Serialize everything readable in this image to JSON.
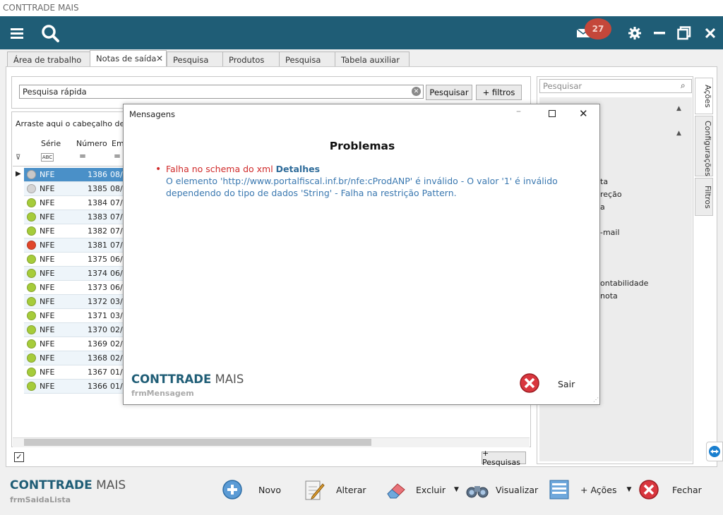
{
  "window": {
    "title": "CONTTRADE MAIS"
  },
  "header": {
    "notification_count": "27",
    "accent": "#1f5d76"
  },
  "tabs": [
    {
      "label": "Área de trabalho"
    },
    {
      "label": "Notas de saída"
    },
    {
      "label": "Pesquisa"
    },
    {
      "label": "Produtos"
    },
    {
      "label": "Pesquisa"
    },
    {
      "label": "Tabela auxiliar"
    }
  ],
  "search": {
    "placeholder": "Pesquisa rápida",
    "search_button": "Pesquisar",
    "filters_button": "+ filtros"
  },
  "grid": {
    "group_hint": "Arraste aqui o cabeçalho de uma coluna",
    "columns": [
      "Série",
      "Número",
      "Emissão"
    ],
    "filter_symbol": "=",
    "rows": [
      {
        "status": "#c8c8c8",
        "serie": "NFE",
        "numero": "1386",
        "data": "08/"
      },
      {
        "status": "#d4d4d4",
        "serie": "NFE",
        "numero": "1385",
        "data": "08/"
      },
      {
        "status": "#a6cc3a",
        "serie": "NFE",
        "numero": "1384",
        "data": "07/"
      },
      {
        "status": "#a6cc3a",
        "serie": "NFE",
        "numero": "1383",
        "data": "07/"
      },
      {
        "status": "#a6cc3a",
        "serie": "NFE",
        "numero": "1382",
        "data": "07/"
      },
      {
        "status": "#e0452a",
        "serie": "NFE",
        "numero": "1381",
        "data": "07/"
      },
      {
        "status": "#a6cc3a",
        "serie": "NFE",
        "numero": "1375",
        "data": "06/"
      },
      {
        "status": "#a6cc3a",
        "serie": "NFE",
        "numero": "1374",
        "data": "06/"
      },
      {
        "status": "#a6cc3a",
        "serie": "NFE",
        "numero": "1373",
        "data": "06/"
      },
      {
        "status": "#a6cc3a",
        "serie": "NFE",
        "numero": "1372",
        "data": "03/"
      },
      {
        "status": "#a6cc3a",
        "serie": "NFE",
        "numero": "1371",
        "data": "03/"
      },
      {
        "status": "#a6cc3a",
        "serie": "NFE",
        "numero": "1370",
        "data": "02/"
      },
      {
        "status": "#a6cc3a",
        "serie": "NFE",
        "numero": "1369",
        "data": "02/"
      },
      {
        "status": "#a6cc3a",
        "serie": "NFE",
        "numero": "1368",
        "data": "02/"
      },
      {
        "status": "#a6cc3a",
        "serie": "NFE",
        "numero": "1367",
        "data": "01/"
      },
      {
        "status": "#a6cc3a",
        "serie": "NFE",
        "numero": "1366",
        "data": "01/"
      }
    ],
    "more_searches_button": "+ Pesquisas"
  },
  "side_panel": {
    "search_placeholder": "Pesquisar",
    "items": [
      "ta",
      "reção",
      "a",
      "-mail",
      "ontabilidade",
      "nota"
    ],
    "vertical_tabs": [
      "Ações",
      "Configurações",
      "Filtros"
    ]
  },
  "modal": {
    "title": "Mensagens",
    "heading": "Problemas",
    "error_title": "Falha no schema do xml",
    "details_link": "Detalhes",
    "error_line1": "O elemento 'http://www.portalfiscal.inf.br/nfe:cProdANP' é inválido - O valor '1' é inválido",
    "error_line2": "dependendo do tipo de dados 'String' - Falha na restrição Pattern.",
    "brand_part1": "CONTTRADE",
    "brand_part2": "MAIS",
    "form_name": "frmMensagem",
    "exit_label": "Sair"
  },
  "footer": {
    "brand_part1": "CONTTRADE",
    "brand_part2": "MAIS",
    "form_name": "frmSaidaLista",
    "actions": [
      {
        "label": "Novo",
        "icon": "plus-circle-icon"
      },
      {
        "label": "Alterar",
        "icon": "edit-pen-icon"
      },
      {
        "label": "Excluir",
        "icon": "eraser-icon"
      },
      {
        "label": "Visualizar",
        "icon": "binoculars-icon"
      },
      {
        "label": "+ Ações",
        "icon": "list-icon"
      },
      {
        "label": "Fechar",
        "icon": "close-circle-icon"
      }
    ]
  }
}
